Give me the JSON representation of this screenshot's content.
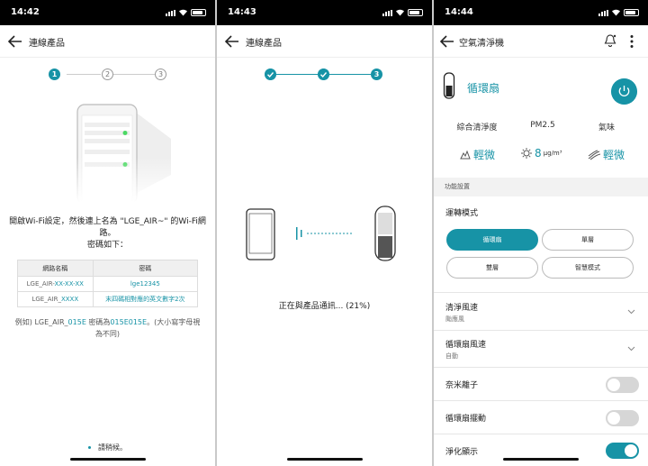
{
  "screen1": {
    "status": {
      "time": "14:42"
    },
    "appbar": {
      "title": "連線產品"
    },
    "steps": [
      "1",
      "2",
      "3"
    ],
    "message": "開啟Wi-Fi設定，然後連上名為 \"LGE_AIR~\" 的Wi-Fi網路。",
    "message2": "密碼如下：",
    "table": {
      "headers": [
        "網路名稱",
        "密碼"
      ],
      "rows": [
        {
          "name_prefix": "LGE_AIR-",
          "name_suffix": "XX-XX-XX",
          "password": "lge12345"
        },
        {
          "name_prefix": "LGE_AIR_",
          "name_suffix": "XXXX",
          "password": "末四碼相對應的英文數字2次"
        }
      ]
    },
    "example": {
      "prefix": "例如) LGE_AIR_",
      "code": "015E",
      "middle": " 密碼為",
      "pw": "015E015E",
      "suffix": "。(大小寫字母視為不同)"
    },
    "wait": "請稍候。"
  },
  "screen2": {
    "status": {
      "time": "14:43"
    },
    "appbar": {
      "title": "連線產品"
    },
    "current_step": "3",
    "progress_text": "正在與產品通訊... (21%)"
  },
  "screen3": {
    "status": {
      "time": "14:44"
    },
    "appbar": {
      "title": "空氣清淨機"
    },
    "device_mode": "循環扇",
    "metrics": [
      {
        "label": "綜合清淨度",
        "value": "輕微"
      },
      {
        "label": "PM2.5",
        "value": "8",
        "unit": "μg/m³"
      },
      {
        "label": "氣味",
        "value": "輕微"
      }
    ],
    "section": "功能設置",
    "operation_label": "運轉模式",
    "modes": [
      "循環扇",
      "單層",
      "雙層",
      "智慧模式"
    ],
    "active_mode": "循環扇",
    "rows": [
      {
        "label": "清淨風速",
        "value": "颱應風"
      },
      {
        "label": "循環扇風速",
        "value": "自動"
      }
    ],
    "toggles": [
      {
        "label": "奈米離子",
        "on": false
      },
      {
        "label": "循環扇擺動",
        "on": false
      },
      {
        "label": "淨化顯示",
        "on": true
      }
    ]
  },
  "colors": {
    "accent": "#1793a6"
  }
}
